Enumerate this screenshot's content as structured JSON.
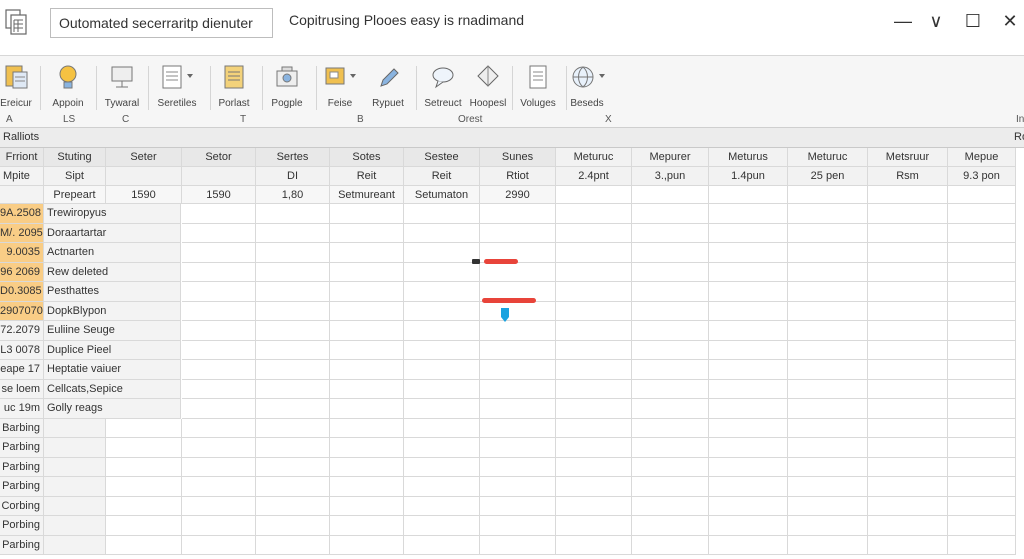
{
  "window": {
    "doc_box": "Outomated secerraritp dienuter",
    "title": "Copitrusing Plooes easy is rnadimand",
    "controls": {
      "minimize": "—",
      "restore": "∨",
      "maximize": "☐",
      "close": "✕"
    }
  },
  "ribbon": {
    "buttons": [
      {
        "label": "Ereicur"
      },
      {
        "label": "Appoin"
      },
      {
        "label": "Tywaral"
      },
      {
        "label": "Seretiles"
      },
      {
        "label": "Porlast"
      },
      {
        "label": "Pogple"
      },
      {
        "label": "Feise"
      },
      {
        "label": "Rypuet"
      },
      {
        "label": "Setreuct"
      },
      {
        "label": "Hoopesl"
      },
      {
        "label": "Voluges"
      },
      {
        "label": "Beseds"
      }
    ],
    "groups": [
      "A",
      "LS",
      "C",
      "T",
      "B",
      "Orest",
      "X"
    ],
    "right_marker": "In"
  },
  "sheet": {
    "top_label": "Ralliots",
    "top_right": "Ro",
    "header1": [
      "Frriont",
      "Stuting",
      "Seter",
      "Setor",
      "Sertes",
      "Sotes",
      "Sestee",
      "Sunes",
      "Meturuc",
      "Mepurer",
      "Meturus",
      "Meturuc",
      "Metsruur",
      "Mepue"
    ],
    "header2": [
      "Mpite",
      "Sipt",
      "",
      "",
      "DI",
      "Reit",
      "Reit",
      "Rtiot",
      "2.4pnt",
      "3.,pun",
      "1.4pun",
      "25 pen",
      "Rsm",
      "9.3 pon"
    ],
    "header3": [
      "",
      "Prepeart",
      "1590",
      "1590",
      "1,80",
      "Setmureant",
      "Setumaton",
      "2990",
      "",
      "",
      "",
      "",
      "",
      ""
    ],
    "rows": [
      {
        "label": "9A.2508",
        "name": "Trewiropyus",
        "hl": true
      },
      {
        "label": "M/. 2095",
        "name": "Doraartartar",
        "hl": true
      },
      {
        "label": "9.0035",
        "name": "Actnarten",
        "hl": true
      },
      {
        "label": "96 2069",
        "name": "Rew deleted",
        "hl": true
      },
      {
        "label": "D0.3085",
        "name": "Pesthattes",
        "hl": true
      },
      {
        "label": "2907070",
        "name": "DopkBlypon",
        "hl": true
      },
      {
        "label": "72.2079",
        "name": "Euliine Seuge",
        "hl": false
      },
      {
        "label": "L3 0078",
        "name": "Duplice Pieel",
        "hl": false
      },
      {
        "label": "eape 17",
        "name": "Heptatie vaiuer",
        "hl": false
      },
      {
        "label": "se loem",
        "name": "Cellcats,Sepice",
        "hl": false
      },
      {
        "label": "uc 19m",
        "name": "Golly reags",
        "hl": false
      },
      {
        "label": "Barbing",
        "name": "",
        "hl": false
      },
      {
        "label": "Parbing",
        "name": "",
        "hl": false
      },
      {
        "label": "Parbing",
        "name": "",
        "hl": false
      },
      {
        "label": "Parbing",
        "name": "",
        "hl": false
      },
      {
        "label": "Corbing",
        "name": "",
        "hl": false
      },
      {
        "label": "Porbing",
        "name": "",
        "hl": false
      },
      {
        "label": "Parbing",
        "name": "",
        "hl": false
      }
    ]
  },
  "colors": {
    "highlight": "#f9cd86",
    "redbar": "#e8443a",
    "cursor": "#1aa3e0"
  }
}
